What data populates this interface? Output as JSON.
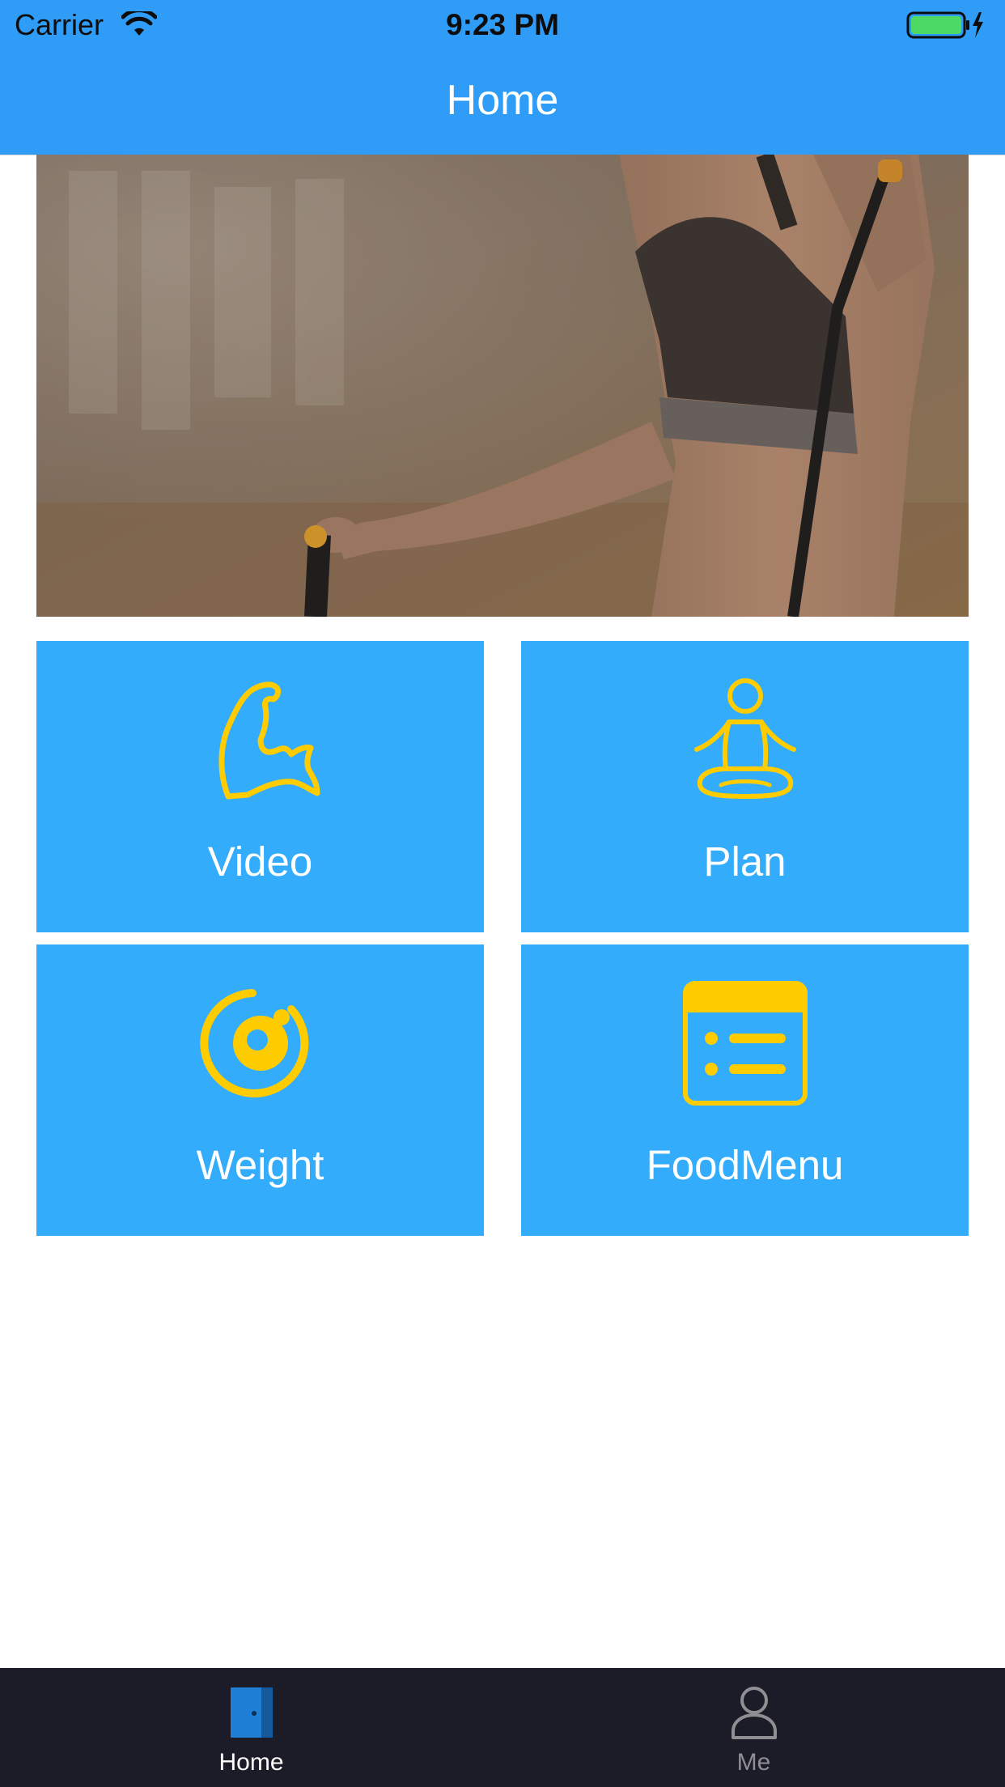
{
  "status_bar": {
    "carrier": "Carrier",
    "time": "9:23 PM",
    "wifi_icon": "wifi-icon",
    "battery_icon": "battery-charging-icon"
  },
  "nav": {
    "title": "Home"
  },
  "banner": {
    "image": "fitness-woman-resistance-band-photo"
  },
  "tiles": [
    {
      "label": "Video",
      "icon": "flexed-arm-icon"
    },
    {
      "label": "Plan",
      "icon": "meditation-icon"
    },
    {
      "label": "Weight",
      "icon": "target-ring-icon"
    },
    {
      "label": "FoodMenu",
      "icon": "list-card-icon"
    }
  ],
  "tabbar": {
    "items": [
      {
        "label": "Home",
        "icon": "door-icon",
        "selected": true
      },
      {
        "label": "Me",
        "icon": "person-icon",
        "selected": false
      }
    ]
  },
  "colors": {
    "nav_blue": "#2f9cf8",
    "tile_blue": "#33acfc",
    "icon_yellow": "#ffcc00",
    "tabbar_bg": "#1c1c28",
    "tab_active": "#1a6fbf",
    "tab_inactive": "#8e8e93"
  }
}
